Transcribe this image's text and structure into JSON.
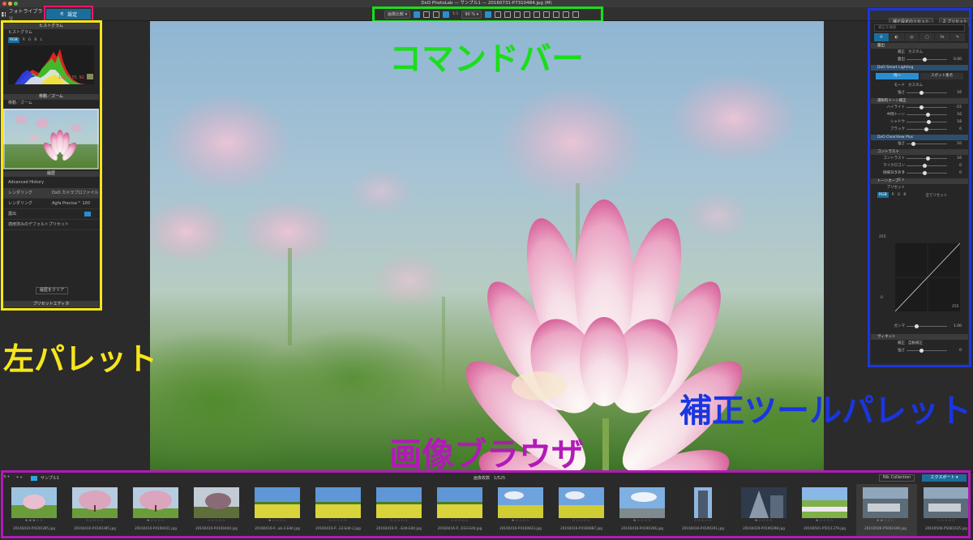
{
  "window": {
    "title": "DxO PhotoLab — サンプル1 — 20160731-P7310484.jpg (M)"
  },
  "top_tabs": {
    "library": "フォトライブラリ",
    "customize": "設定"
  },
  "command_bar": {
    "compare": "画像比較",
    "ratio": "1:1",
    "zoom": "90 %"
  },
  "right_top": {
    "reset": "補正設定のリセット",
    "preset": "Z プリセット"
  },
  "left_palette": {
    "histogram_header": "ヒストグラム",
    "histogram_label": "ヒストグラム",
    "channels": [
      "RGB",
      "R",
      "G",
      "B",
      "L"
    ],
    "rgb_readout": "189, 170, 92",
    "move_zoom_header": "移動／ズーム",
    "move_zoom_sub": "移動／ズーム",
    "history_header": "履歴",
    "history_sub": "Advanced History",
    "history_items": [
      {
        "left": "レンダリング",
        "right": "DxO カメラプロファイル"
      },
      {
        "left": "レンダリング",
        "right": "Agfa Precisa™ 100"
      },
      {
        "left": "露出",
        "right": ""
      },
      {
        "left": "適用済みのデフォルトプリセット",
        "right": ""
      }
    ],
    "clear_button": "履歴をクリア",
    "preset_editor": "プリセットエディタ"
  },
  "right_palette": {
    "search_placeholder": "補正を検索",
    "tabs": [
      "☼",
      "◐",
      "◎",
      "▢",
      "fx",
      "✎"
    ],
    "exposure_header": "露出",
    "exposure_rows": [
      {
        "label": "補正",
        "text": "カスタム"
      },
      {
        "label": "露出",
        "value": "0.00"
      }
    ],
    "smart_header": "DxO Smart Lighting",
    "smart_chips": [
      "均一",
      "スポット重点"
    ],
    "smart_rows": [
      {
        "label": "モード",
        "text": "カスタム"
      },
      {
        "label": "強さ",
        "value": "16"
      }
    ],
    "tone_header": "選択的トーン補正",
    "tone_rows": [
      {
        "label": "ハイライト",
        "value": "-15"
      },
      {
        "label": "中間トーン",
        "value": "16"
      },
      {
        "label": "シャドウ",
        "value": "18"
      },
      {
        "label": "ブラック",
        "value": "6"
      }
    ],
    "clearview_header": "DxO ClearView Plus",
    "clearview_rows": [
      {
        "label": "強さ",
        "value": "10"
      }
    ],
    "contrast_header": "コントラスト",
    "contrast_rows": [
      {
        "label": "コントラスト",
        "value": "16"
      },
      {
        "label": "マイクロコントラスト",
        "value": "0"
      },
      {
        "label": "微細コントラスト",
        "value": "0"
      }
    ],
    "tonecurve_header": "トーンカーブ",
    "tonecurve_preset": "プリセット",
    "tonecurve_channels": [
      "RGB",
      "R",
      "G",
      "B"
    ],
    "tonecurve_reset": "全てリセット",
    "tonecurve_top": "255",
    "tonecurve_bottom": "0",
    "tonecurve_right": "255",
    "gamma_label": "ガンマ",
    "gamma_value": "1.00",
    "vignette_header": "ヴィネット",
    "vignette_rows": [
      {
        "label": "補正",
        "text": "自動補正"
      },
      {
        "label": "強さ",
        "value": "0"
      }
    ]
  },
  "labels": {
    "command_bar": "コマンドバー",
    "left_palette": "左パレット",
    "tools_palette": "補正ツールパレット",
    "image_browser": "画像ブラウザ"
  },
  "browser": {
    "folder": "サンプル1",
    "count_label": "画像枚数",
    "count": "1/525",
    "nik": "Nik Collection",
    "export": "エクスポート",
    "thumbnails": [
      {
        "file": "20160410-P4100385.jpg",
        "stars": "★★★☆☆",
        "kind": "sakura-field"
      },
      {
        "file": "20160410-P4100385.jpg",
        "stars": "☆☆☆☆☆",
        "kind": "sakura-tree"
      },
      {
        "file": "20160410-P4100421.jpg",
        "stars": "★☆☆☆☆",
        "kind": "sakura-tree"
      },
      {
        "file": "20160410-P4100444.jpg",
        "stars": "☆☆☆☆☆",
        "kind": "tree-dark"
      },
      {
        "file": "20160416-P...ab-2-Edit.jpg",
        "stars": "★☆☆☆☆",
        "kind": "rape-field"
      },
      {
        "file": "20160416-P...33-Edit-2.jpg",
        "stars": "☆☆☆☆☆",
        "kind": "rape-field"
      },
      {
        "file": "20160416-P...-Edit-Edit.jpg",
        "stars": "☆☆☆☆☆",
        "kind": "rape-field"
      },
      {
        "file": "20160416-P...D33-Edit.jpg",
        "stars": "☆☆☆☆☆",
        "kind": "rape-field"
      },
      {
        "file": "20160416-P4160833.jpg",
        "stars": "★☆☆☆☆",
        "kind": "rape-sky"
      },
      {
        "file": "20160416-P4160887.jpg",
        "stars": "☆☆☆☆☆",
        "kind": "rape-sky"
      },
      {
        "file": "20160416-P4190266.jpg",
        "stars": "★☆☆☆☆",
        "kind": "city-sky"
      },
      {
        "file": "20160416-P4190291.jpg",
        "stars": "☆☆☆☆☆",
        "kind": "tower"
      },
      {
        "file": "20160419-P4190298.jpg",
        "stars": "★☆☆☆☆",
        "kind": "tower-dark"
      },
      {
        "file": "20160501-P5011379.jpg",
        "stars": "★☆☆☆☆",
        "kind": "flower-hill"
      },
      {
        "file": "20160506-P5061609.jpg",
        "stars": "★★☆☆☆",
        "kind": "aerial"
      },
      {
        "file": "20160506-P5061635.jpg",
        "stars": "☆☆☆☆☆",
        "kind": "aerial"
      }
    ]
  },
  "colors": {
    "accent": "#1b6e9c",
    "label_green": "#1bde1b",
    "label_yellow": "#f6e51c",
    "label_blue": "#1a36e0",
    "label_purple": "#b21ab8",
    "label_red": "#e8186a"
  }
}
